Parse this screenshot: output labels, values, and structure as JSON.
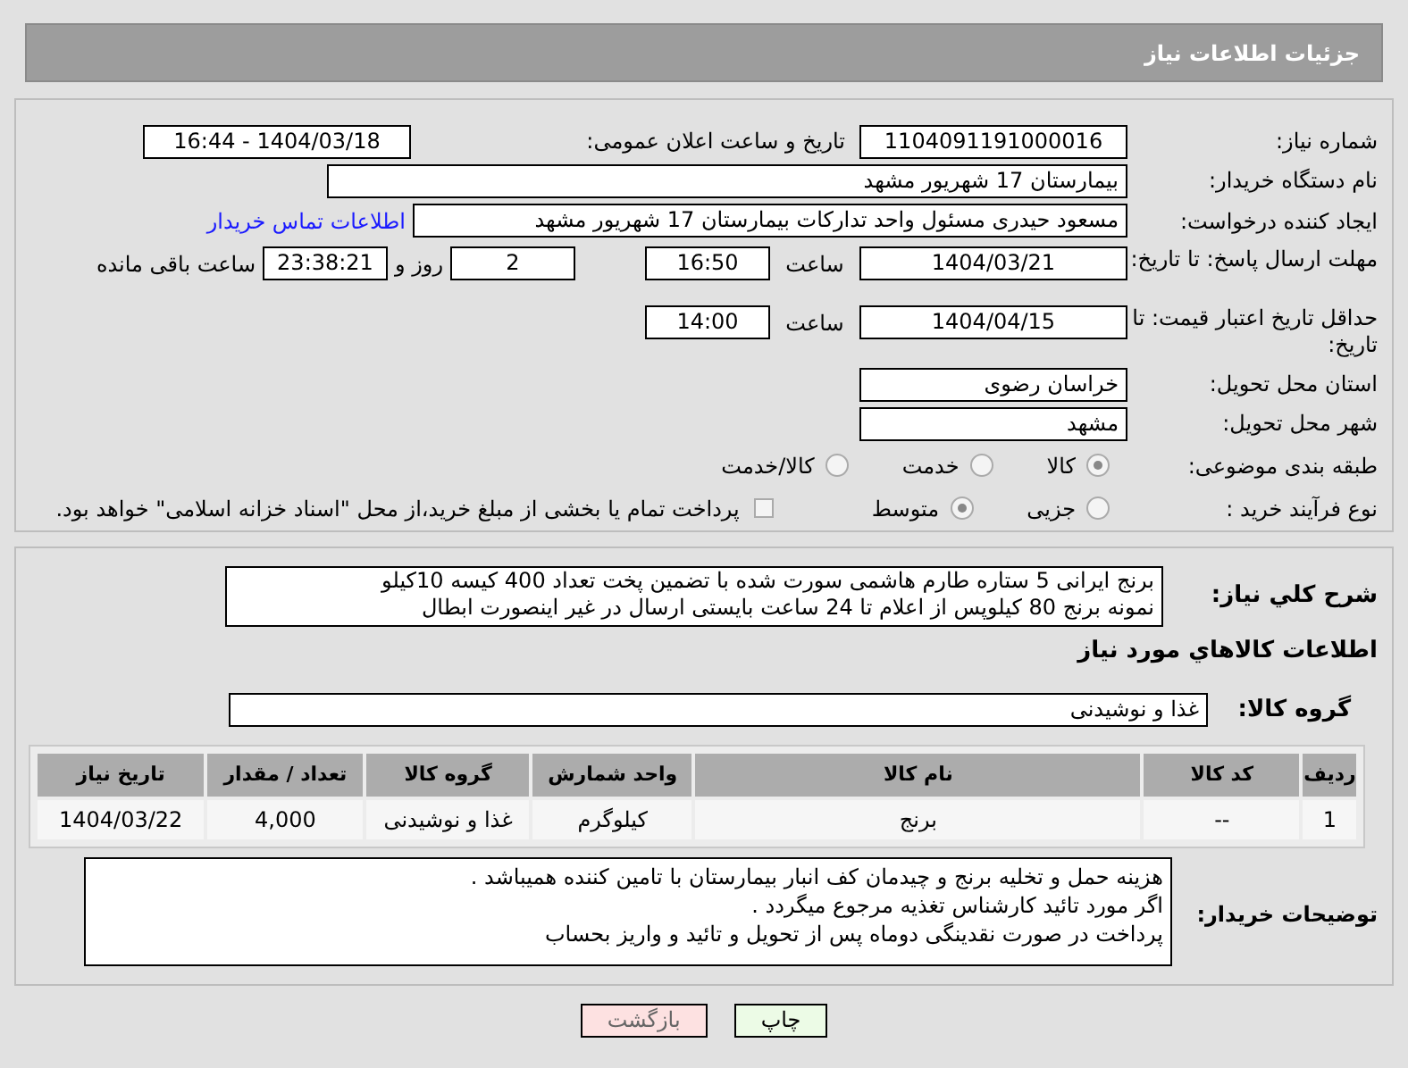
{
  "page_title": "جزئیات اطلاعات نیاز",
  "need_number": {
    "label": "شماره نیاز:",
    "value": "1104091191000016"
  },
  "announce": {
    "label": "تاریخ و ساعت اعلان عمومی:",
    "value": "1404/03/18 - 16:44"
  },
  "buyer_org": {
    "label": "نام دستگاه خریدار:",
    "value": "بیمارستان 17 شهریور مشهد"
  },
  "requester": {
    "label": "ایجاد کننده درخواست:",
    "value": "مسعود حیدری مسئول واحد تدارکات  بیمارستان 17 شهریور مشهد",
    "link": "اطلاعات تماس خریدار"
  },
  "deadline": {
    "label": "مهلت ارسال پاسخ: تا تاریخ:",
    "date": "1404/03/21",
    "time_label": "ساعت",
    "time": "16:50",
    "days": "2",
    "days_label": "روز و",
    "remaining": "23:38:21",
    "remaining_label": "ساعت باقی مانده"
  },
  "validity": {
    "label": "حداقل تاریخ اعتبار قیمت: تا تاریخ:",
    "date": "1404/04/15",
    "time_label": "ساعت",
    "time": "14:00"
  },
  "province": {
    "label": "استان محل تحویل:",
    "value": "خراسان رضوی"
  },
  "city": {
    "label": "شهر محل تحویل:",
    "value": "مشهد"
  },
  "category": {
    "label": "طبقه بندی موضوعی:",
    "options": [
      {
        "label": "کالا",
        "selected": true
      },
      {
        "label": "خدمت",
        "selected": false
      },
      {
        "label": "کالا/خدمت",
        "selected": false
      }
    ]
  },
  "process": {
    "label": "نوع فرآیند خرید :",
    "options": [
      {
        "label": "جزیی",
        "selected": false
      },
      {
        "label": "متوسط",
        "selected": true
      }
    ],
    "payment_note": {
      "label": "پرداخت تمام یا بخشی از مبلغ خرید،از محل \"اسناد خزانه اسلامی\" خواهد بود.",
      "checked": false
    }
  },
  "description": {
    "label": "شرح کلي نیاز:",
    "lines": [
      "برنج ایرانی 5 ستاره طارم هاشمی سورت شده با تضمین پخت تعداد 400 کیسه 10کیلو",
      "نمونه برنج 80 کیلوپس از اعلام تا 24 ساعت بایستی ارسال در غیر اینصورت ابطال"
    ]
  },
  "goods_heading": "اطلاعات کالاهاي مورد نیاز",
  "goods_group": {
    "label": "گروه کالا:",
    "value": "غذا و نوشیدنی"
  },
  "table": {
    "columns": [
      "ردیف",
      "کد کالا",
      "نام کالا",
      "واحد شمارش",
      "گروه کالا",
      "تعداد / مقدار",
      "تاریخ نیاز"
    ],
    "rows": [
      [
        "1",
        "--",
        "برنج",
        "کیلوگرم",
        "غذا و نوشیدنی",
        "4,000",
        "1404/03/22"
      ]
    ]
  },
  "buyer_notes": {
    "label": "توضیحات خریدار:",
    "lines": [
      "هزینه حمل و تخلیه برنج و چیدمان کف انبار بیمارستان با تامین کننده همیباشد .",
      "اگر مورد تائید کارشناس تغذیه مرجوع میگردد .",
      "پرداخت در صورت نقدینگی دوماه پس از تحویل و تائید و واریز بحساب"
    ]
  },
  "buttons": [
    {
      "label": "چاپ",
      "kind": "print"
    },
    {
      "label": "بازگشت",
      "kind": "back"
    }
  ]
}
